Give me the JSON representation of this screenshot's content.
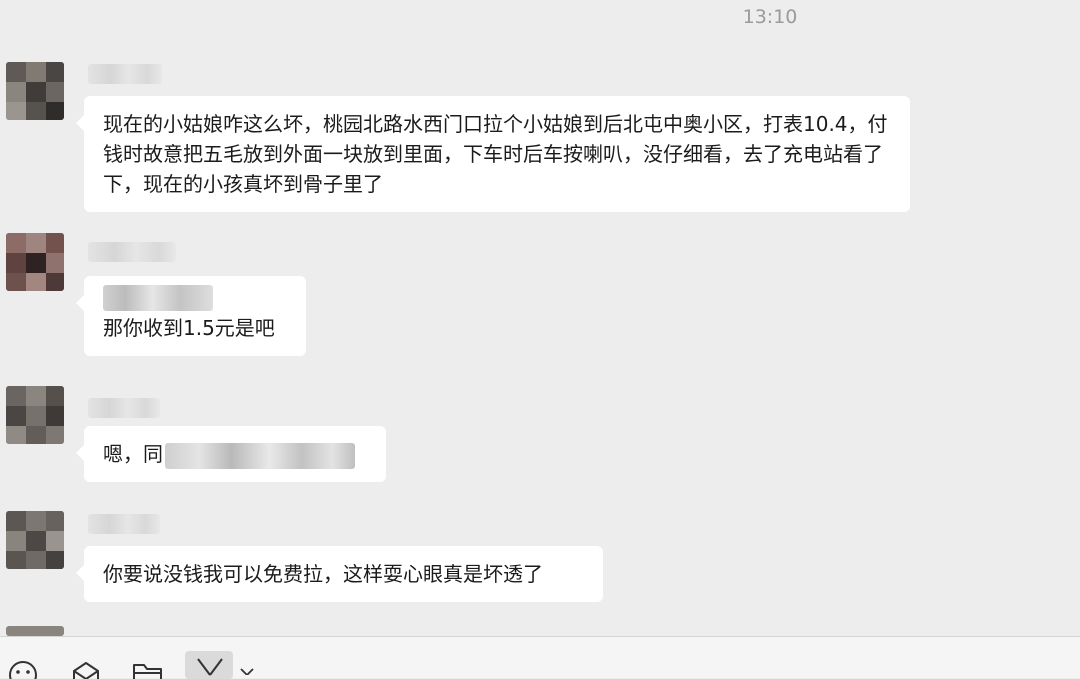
{
  "chat": {
    "timestamp": "13:10",
    "messages": [
      {
        "text": "现在的小姑娘咋这么坏，桃园北路水西门口拉个小姑娘到后北屯中奥小区，打表10.4，付钱时故意把五毛放到外面一块放到里面，下车时后车按喇叭，没仔细看，去了充电站看了下，现在的小孩真坏到骨子里了"
      },
      {
        "quoted_text": "",
        "text": "那你收到1.5元是吧"
      },
      {
        "text": "嗯，同"
      },
      {
        "text": "你要说没钱我可以免费拉，这样耍心眼真是坏透了"
      }
    ]
  },
  "toolbar": {
    "icons": [
      "emoji-icon",
      "favorites-icon",
      "folder-icon",
      "scissors-icon",
      "dropdown-chevron-icon"
    ]
  },
  "colors": {
    "background": "#ededed",
    "bubble": "#ffffff",
    "timestamp": "#9a9a9a"
  }
}
